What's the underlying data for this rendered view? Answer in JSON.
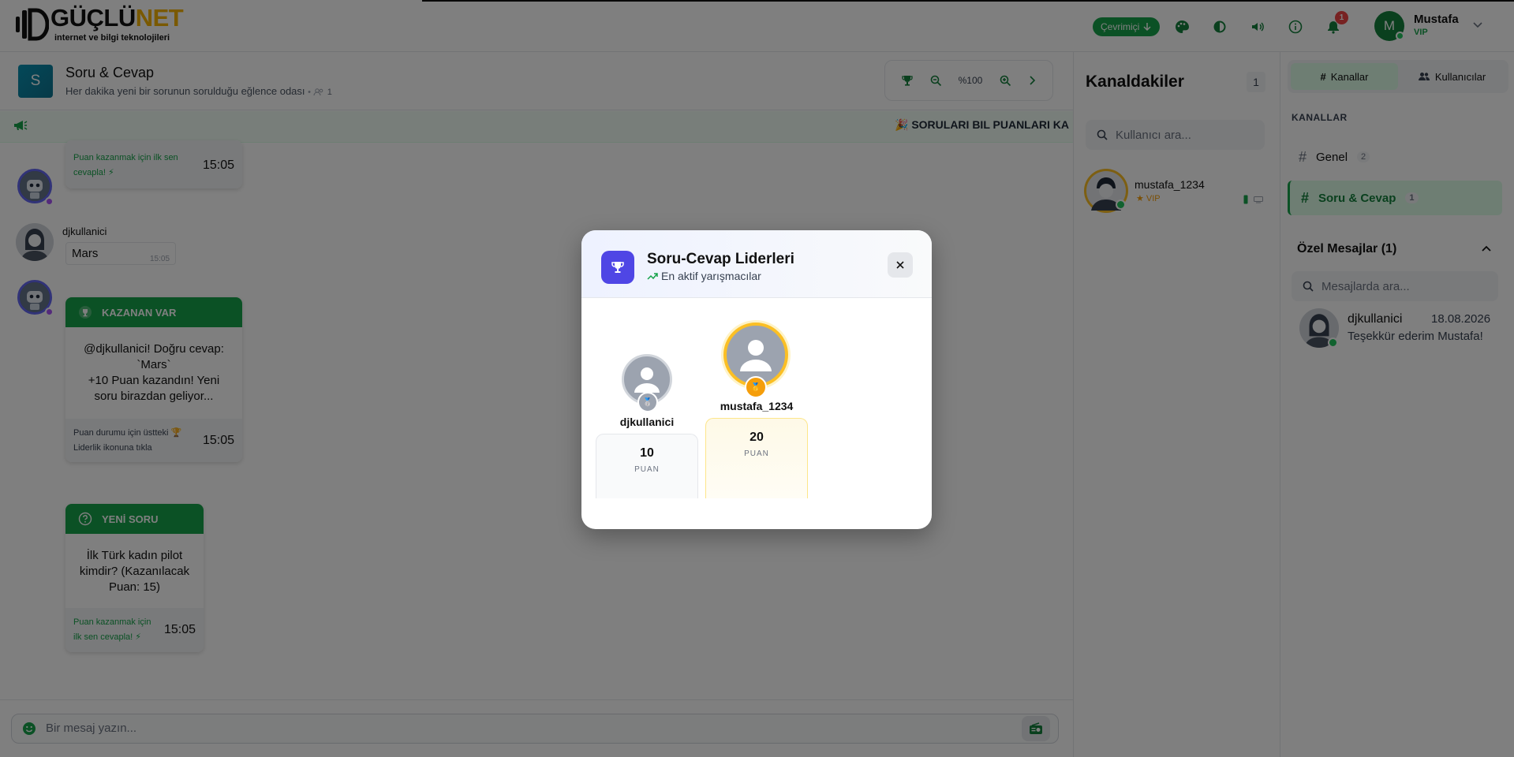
{
  "header": {
    "logo_main": "GÜÇLÜ",
    "logo_accent": "NET",
    "logo_tagline": "internet ve bilgi teknolojileri",
    "status_label": "Çevrimiçi",
    "notification_count": "1",
    "user_initial": "M",
    "user_name": "Mustafa",
    "user_role": "VIP"
  },
  "channel": {
    "avatar_letter": "S",
    "title": "Soru & Cevap",
    "subtitle": "Her dakika yeni bir sorunun sorulduğu eğlence odası",
    "member_count": "1",
    "zoom": "%100"
  },
  "marquee": {
    "text": "🎉 SORULARI BIL PUANLARI KA"
  },
  "messages": {
    "m1_note": "Puan kazanmak için ilk sen cevapla! ⚡",
    "m1_time": "15:05",
    "m2_user": "djkullanici",
    "m2_text": "Mars",
    "m2_time": "15:05",
    "m3_title": "KAZANAN VAR",
    "m3_body": "@djkullanici! Doğru cevap: `Mars`\n+10 Puan kazandın! Yeni soru birazdan geliyor...",
    "m3_note": "Puan durumu için üstteki 🏆 Liderlik ikonuna tıkla",
    "m3_time": "15:05",
    "m4_title": "YENİ SORU",
    "m4_body": "İlk Türk kadın pilot kimdir? (Kazanılacak Puan: 15)",
    "m4_note": "Puan kazanmak için ilk sen cevapla! ⚡",
    "m4_time": "15:05"
  },
  "input": {
    "placeholder": "Bir mesaj yazın..."
  },
  "members": {
    "title": "Kanaldakiler",
    "count": "1",
    "search_placeholder": "Kullanıcı ara...",
    "list": [
      {
        "name": "mustafa_1234",
        "role": "★ VIP"
      }
    ]
  },
  "sidebar": {
    "tab_channels": "Kanallar",
    "tab_users": "Kullanıcılar",
    "section_label": "KANALLAR",
    "channels": [
      {
        "name": "Genel",
        "count": "2"
      },
      {
        "name": "Soru & Cevap",
        "count": "1"
      }
    ],
    "dm_title": "Özel Mesajlar (1)",
    "dm_search": "Mesajlarda ara...",
    "dm_items": [
      {
        "name": "djkullanici",
        "date": "18.08.2026",
        "preview": "Teşekkür ederim Mustafa!"
      }
    ]
  },
  "modal": {
    "title": "Soru-Cevap Liderleri",
    "subtitle": "En aktif yarışmacılar",
    "leaders": [
      {
        "rank": "1",
        "name": "mustafa_1234",
        "points": "20",
        "unit": "PUAN"
      },
      {
        "rank": "2",
        "name": "djkullanici",
        "points": "10",
        "unit": "PUAN"
      }
    ]
  },
  "colors": {
    "brand_green": "#16a34a",
    "modal_accent": "#4f46e5",
    "gold": "#fbbf24",
    "silver": "#9ca3af"
  }
}
